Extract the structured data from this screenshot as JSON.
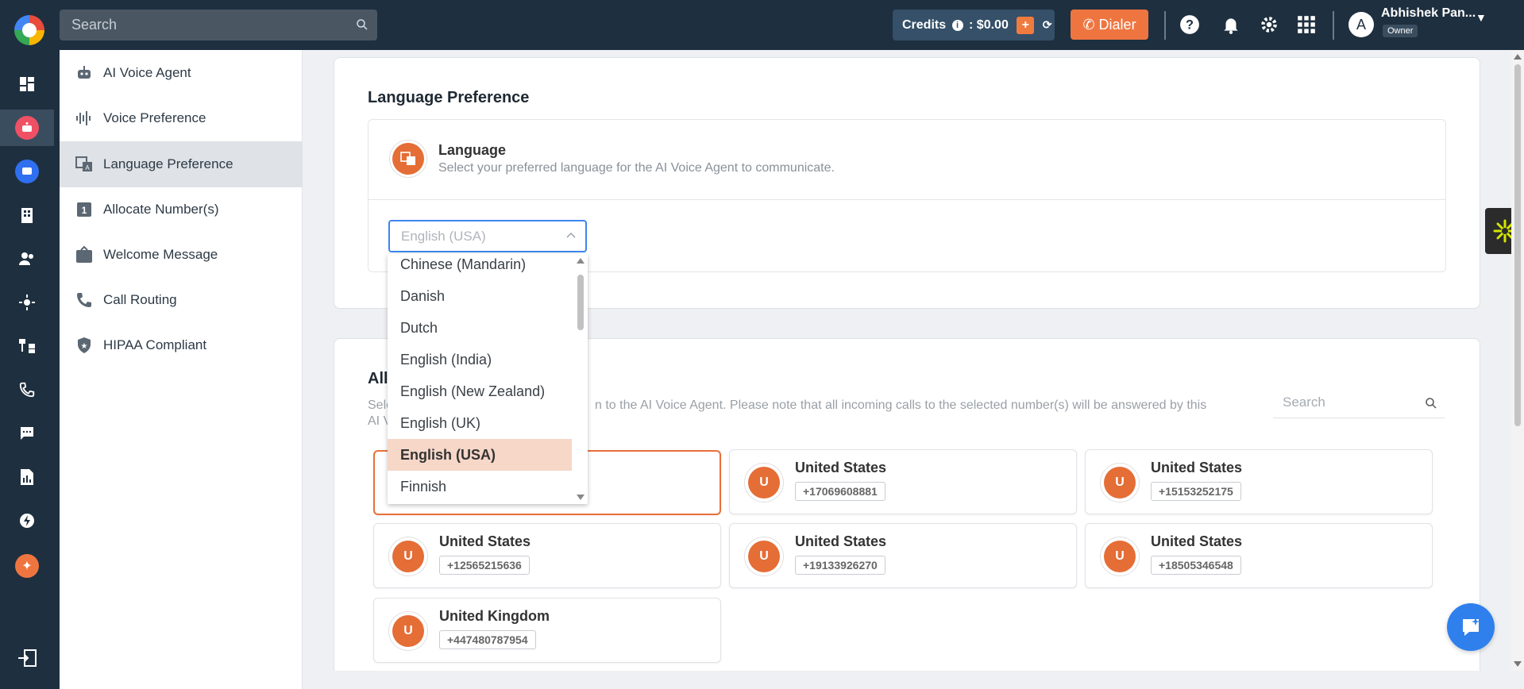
{
  "topbar": {
    "search_placeholder": "Search",
    "credits_label": "Credits",
    "credits_value": ": $0.00",
    "dialer_label": "Dialer",
    "user_initial": "A",
    "user_name": "Abhishek Pan...",
    "user_role": "Owner"
  },
  "subnav": {
    "items": [
      {
        "label": "AI Voice Agent",
        "icon": "robot-icon"
      },
      {
        "label": "Voice Preference",
        "icon": "waveform-icon"
      },
      {
        "label": "Language Preference",
        "icon": "translate-icon"
      },
      {
        "label": "Allocate Number(s)",
        "icon": "number-one-icon"
      },
      {
        "label": "Welcome Message",
        "icon": "welcome-sign-icon"
      },
      {
        "label": "Call Routing",
        "icon": "phone-icon"
      },
      {
        "label": "HIPAA Compliant",
        "icon": "shield-star-icon"
      }
    ],
    "active_index": 2
  },
  "language": {
    "section_title": "Language Preference",
    "title": "Language",
    "description": "Select your preferred language for the AI Voice Agent to communicate.",
    "select_value": "English (USA)",
    "options": [
      "Chinese (Mandarin)",
      "Danish",
      "Dutch",
      "English (India)",
      "English (New Zealand)",
      "English (UK)",
      "English (USA)",
      "Finnish"
    ],
    "selected_option": "English (USA)"
  },
  "numbers": {
    "section_title_partial": "All",
    "description_partial_1": "Sele",
    "description_partial_2": "n to the AI Voice Agent. Please note that all incoming calls to the selected number(s) will be answered by this",
    "description_partial_3": "AI V",
    "search_placeholder": "Search",
    "cards": [
      {
        "initial": "U",
        "country": "United States",
        "phone": "+17069608881"
      },
      {
        "initial": "U",
        "country": "United States",
        "phone": "+15153252175"
      },
      {
        "initial": "U",
        "country": "United States",
        "phone": "+12565215636"
      },
      {
        "initial": "U",
        "country": "United States",
        "phone": "+19133926270"
      },
      {
        "initial": "U",
        "country": "United States",
        "phone": "+18505346548"
      },
      {
        "initial": "U",
        "country": "United Kingdom",
        "phone": "+447480787954"
      }
    ]
  },
  "colors": {
    "topbar_bg": "#1e2f3f",
    "accent_orange": "#e56d36",
    "select_focus": "#3d86ef",
    "selected_option_bg": "#f6d7c8"
  }
}
